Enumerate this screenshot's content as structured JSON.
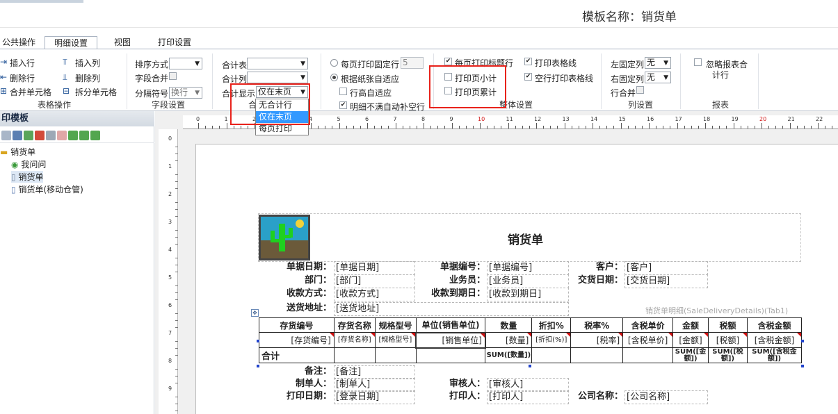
{
  "header": {
    "template_name": "模板名称：销货单"
  },
  "tabs": [
    {
      "label": "公共操作"
    },
    {
      "label": "明细设置"
    },
    {
      "label": "视图"
    },
    {
      "label": "打印设置"
    }
  ],
  "ribbon": {
    "table_ops": {
      "title": "表格操作",
      "insert_row": "插入行",
      "delete_row": "删除行",
      "merge_cells": "合并单元格",
      "insert_col": "插入列",
      "delete_col": "删除列",
      "split_cells": "拆分单元格"
    },
    "field_settings": {
      "title": "字段设置",
      "sort_label": "排序方式",
      "field_merge_label": "字段合并",
      "separator_label": "分隔符号",
      "separator_value": "换行"
    },
    "totals": {
      "total_table_label": "合计表",
      "total_col_label": "合计列",
      "total_display_label": "合计显示",
      "total_display_value": "仅在末页",
      "title_partial": "合",
      "options": [
        "无合计行",
        "仅在末页",
        "每页打印"
      ]
    },
    "paging": {
      "fixed_rows_label": "每页打印固定行",
      "fixed_rows_value": "5",
      "fit_paper_label": "根据纸张自适应",
      "row_height_label": "行高自适应",
      "fill_blank_label": "明细不满自动补空行"
    },
    "overall": {
      "title": "整体设置",
      "print_title_each_page": "每页打印标题行",
      "print_page_subtotal": "打印页小计",
      "print_page_cumulative": "打印页累计",
      "print_table_lines": "打印表格线",
      "blank_row_lines": "空行打印表格线"
    },
    "columns": {
      "title": "列设置",
      "left_fixed_label": "左固定列",
      "left_fixed_value": "无",
      "right_fixed_label": "右固定列",
      "right_fixed_value": "无",
      "row_merge_label": "行合并"
    },
    "report": {
      "title": "报表",
      "ignore_total_line1": "忽略报表合",
      "ignore_total_line2": "计行"
    }
  },
  "left_panel": {
    "title": "印模板",
    "tree": [
      {
        "label": "销货单"
      },
      {
        "label": "我问问"
      },
      {
        "label": "销货单"
      },
      {
        "label": "销货单(移动仓管)"
      }
    ]
  },
  "ruler": {
    "h_ticks": [
      "0",
      "1",
      "2",
      "3",
      "4",
      "5",
      "6",
      "7",
      "8",
      "9",
      "10",
      "11",
      "12",
      "13",
      "14",
      "15",
      "16",
      "17",
      "18",
      "19",
      "20",
      "21",
      "22"
    ],
    "v_ticks": [
      "0",
      "1",
      "2",
      "3",
      "4",
      "5",
      "6",
      "7",
      "8",
      "9"
    ]
  },
  "report": {
    "title": "销货单",
    "detail_caption": "销货单明细(SaleDeliveryDetails)(Tab1)",
    "head_fields": [
      {
        "label": "单据日期：",
        "value": "[单据日期]"
      },
      {
        "label": "单据编号：",
        "value": "[单据编号]"
      },
      {
        "label": "客户：",
        "value": "[客户]"
      },
      {
        "label": "部门：",
        "value": "[部门]"
      },
      {
        "label": "业务员：",
        "value": "[业务员]"
      },
      {
        "label": "交货日期：",
        "value": "[交货日期]"
      },
      {
        "label": "收款方式：",
        "value": "[收款方式]"
      },
      {
        "label": "收款到期日：",
        "value": "[收款到期日]"
      },
      {
        "label": "送货地址：",
        "value": "[送货地址]"
      }
    ],
    "columns": [
      "存货编号",
      "存货名称",
      "规格型号",
      "单位(销售单位)",
      "数量",
      "折扣%",
      "税率%",
      "含税单价",
      "金额",
      "税额",
      "含税金额"
    ],
    "detail_row": [
      "[存货编号]",
      "[存货名称]",
      "[规格型号]",
      "[销售单位]",
      "[数量]",
      "[折扣(%)]",
      "[税率]",
      "[含税单价]",
      "[金额]",
      "[税额]",
      "[含税金额]"
    ],
    "total_row": [
      "合计",
      "",
      "",
      "",
      "SUM([数量])",
      "",
      "",
      "",
      "SUM([金额])",
      "SUM([税额])",
      "SUM([含税金额])"
    ],
    "foot_fields": [
      {
        "label": "备注：",
        "value": "[备注]"
      },
      {
        "label": "制单人：",
        "value": "[制单人]"
      },
      {
        "label": "审核人：",
        "value": "[审核人]"
      },
      {
        "label": "打印日期：",
        "value": "[登录日期]"
      },
      {
        "label": "打印人：",
        "value": "[打印人]"
      },
      {
        "label": "公司名称：",
        "value": "[公司名称]"
      }
    ]
  },
  "colors": {
    "accent": "#3399ff",
    "highlight_box": "#e8221b",
    "ruler_red": "#d01010"
  }
}
